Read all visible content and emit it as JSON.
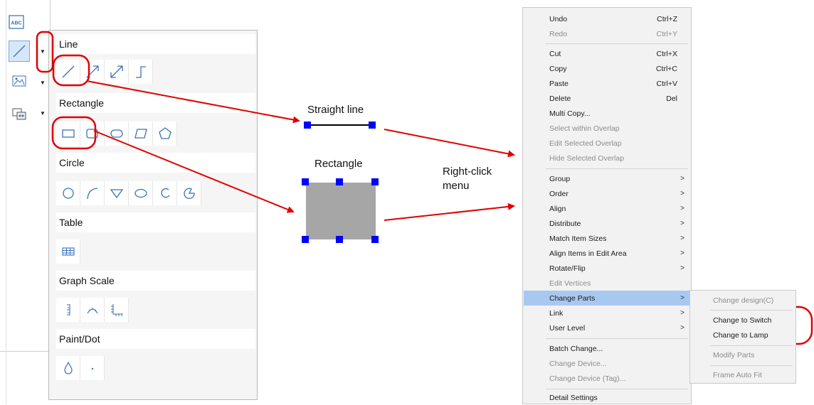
{
  "palette": {
    "sections": [
      {
        "title": "Line",
        "tools": [
          "line-icon",
          "single-arrow-line-icon",
          "double-arrow-line-icon",
          "step-line-icon"
        ]
      },
      {
        "title": "Rectangle",
        "tools": [
          "rectangle-icon",
          "rounded-rectangle-icon",
          "ellipse-rectangle-icon",
          "parallelogram-icon",
          "pentagon-icon"
        ]
      },
      {
        "title": "Circle",
        "tools": [
          "circle-icon",
          "arc-icon",
          "triangle-icon",
          "oval-icon",
          "open-arc-icon",
          "pie-icon"
        ]
      },
      {
        "title": "Table",
        "tools": [
          "table-icon"
        ]
      },
      {
        "title": "Graph Scale",
        "tools": [
          "vertical-scale-icon",
          "arc-scale-icon",
          "xy-scale-icon"
        ]
      },
      {
        "title": "Paint/Dot",
        "tools": [
          "paint-drop-icon",
          "dot-icon"
        ]
      }
    ]
  },
  "toolbar": {
    "abc_label": "ABC"
  },
  "diagram": {
    "straight_line_label": "Straight line",
    "rectangle_label": "Rectangle",
    "right_click_label": "Right-click",
    "menu_label": "menu"
  },
  "context_menu": {
    "items": [
      {
        "label": "Undo",
        "shortcut": "Ctrl+Z",
        "disabled": false
      },
      {
        "label": "Redo",
        "shortcut": "Ctrl+Y",
        "disabled": true
      },
      {
        "label": "Cut",
        "shortcut": "Ctrl+X",
        "disabled": false
      },
      {
        "label": "Copy",
        "shortcut": "Ctrl+C",
        "disabled": false
      },
      {
        "label": "Paste",
        "shortcut": "Ctrl+V",
        "disabled": false
      },
      {
        "label": "Delete",
        "shortcut": "Del",
        "disabled": false
      },
      {
        "label": "Multi Copy...",
        "shortcut": "",
        "disabled": false
      },
      {
        "label": "Select within Overlap",
        "shortcut": "",
        "disabled": true
      },
      {
        "label": "Edit Selected Overlap",
        "shortcut": "",
        "disabled": true
      },
      {
        "label": "Hide Selected Overlap",
        "shortcut": "",
        "disabled": true
      },
      {
        "label": "Group",
        "shortcut": "",
        "disabled": false,
        "submenu": true
      },
      {
        "label": "Order",
        "shortcut": "",
        "disabled": false,
        "submenu": true
      },
      {
        "label": "Align",
        "shortcut": "",
        "disabled": false,
        "submenu": true
      },
      {
        "label": "Distribute",
        "shortcut": "",
        "disabled": false,
        "submenu": true
      },
      {
        "label": "Match Item Sizes",
        "shortcut": "",
        "disabled": false,
        "submenu": true
      },
      {
        "label": "Align Items in Edit Area",
        "shortcut": "",
        "disabled": false,
        "submenu": true
      },
      {
        "label": "Rotate/Flip",
        "shortcut": "",
        "disabled": false,
        "submenu": true
      },
      {
        "label": "Edit Vertices",
        "shortcut": "",
        "disabled": true
      },
      {
        "label": "Change Parts",
        "shortcut": "",
        "disabled": false,
        "submenu": true,
        "highlighted": true
      },
      {
        "label": "Link",
        "shortcut": "",
        "disabled": false,
        "submenu": true
      },
      {
        "label": "User Level",
        "shortcut": "",
        "disabled": false,
        "submenu": true
      },
      {
        "label": "Batch Change...",
        "shortcut": "",
        "disabled": false
      },
      {
        "label": "Change Device...",
        "shortcut": "",
        "disabled": true
      },
      {
        "label": "Change Device (Tag)...",
        "shortcut": "",
        "disabled": true
      },
      {
        "label": "Detail Settings",
        "shortcut": "",
        "disabled": false
      }
    ],
    "submenu_arrow": ">"
  },
  "submenu": {
    "items": [
      {
        "label": "Change design(C)",
        "disabled": true
      },
      {
        "label": "Change to Switch",
        "disabled": false
      },
      {
        "label": "Change to Lamp",
        "disabled": false
      },
      {
        "label": "Modify Parts",
        "disabled": true
      },
      {
        "label": "Frame Auto Fit",
        "disabled": true
      }
    ]
  },
  "colors": {
    "annotation_red": "#e00000",
    "handle_blue": "#0000ff",
    "rect_fill": "#a6a6a6",
    "highlight": "#a8c8f0",
    "icon_blue": "#2f6fb5"
  }
}
